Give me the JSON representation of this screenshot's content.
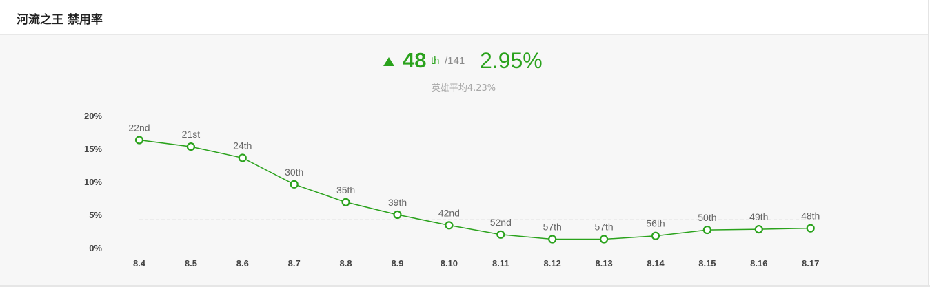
{
  "header": {
    "title": "河流之王 禁用率"
  },
  "summary": {
    "trend": "up",
    "rank": "48",
    "rank_suffix": "th",
    "rank_total": "/141",
    "rate": "2.95%",
    "average": "英雄平均4.23%"
  },
  "colors": {
    "accent": "#2aa21c",
    "average_line": "#9a9a9a"
  },
  "chart_data": {
    "type": "line",
    "title": "",
    "xlabel": "",
    "ylabel": "",
    "categories": [
      "8.4",
      "8.5",
      "8.6",
      "8.7",
      "8.8",
      "8.9",
      "8.10",
      "8.11",
      "8.12",
      "8.13",
      "8.14",
      "8.15",
      "8.16",
      "8.17"
    ],
    "series": [
      {
        "values": [
          16.3,
          15.3,
          13.6,
          9.6,
          6.9,
          5.0,
          3.4,
          2.0,
          1.3,
          1.3,
          1.8,
          2.7,
          2.8,
          2.95
        ],
        "point_labels": [
          "22nd",
          "21st",
          "24th",
          "30th",
          "35th",
          "39th",
          "42nd",
          "52nd",
          "57th",
          "57th",
          "56th",
          "50th",
          "49th",
          "48th"
        ]
      }
    ],
    "average_value": 4.23,
    "ylim": [
      0,
      20
    ],
    "yticks": [
      0,
      5,
      10,
      15,
      20
    ],
    "ytick_labels": [
      "0%",
      "5%",
      "10%",
      "15%",
      "20%"
    ],
    "grid": false,
    "legend": "none"
  }
}
